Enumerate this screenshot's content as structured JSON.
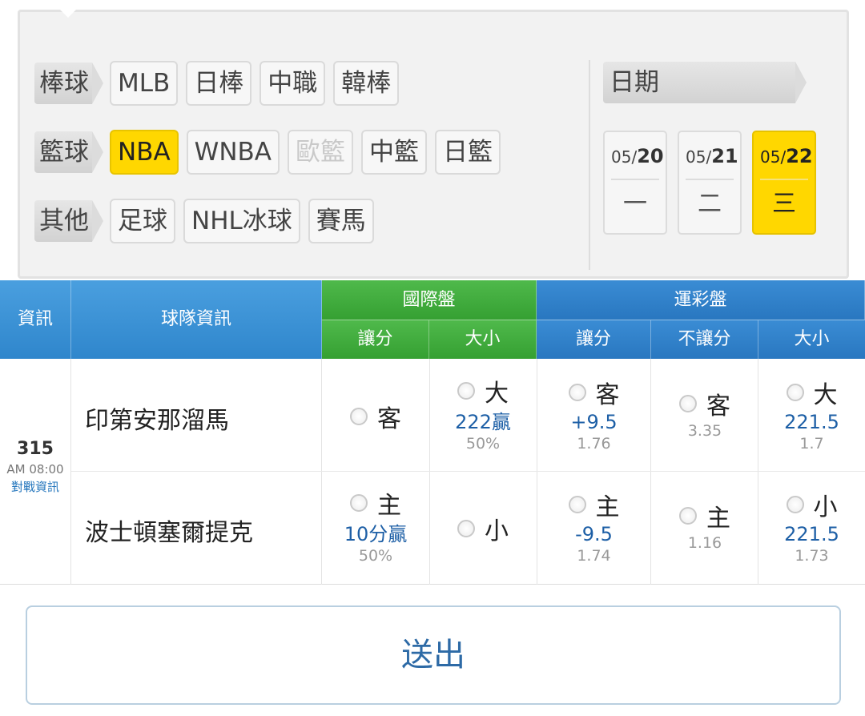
{
  "filters": {
    "rows": [
      {
        "category": "棒球",
        "chips": [
          {
            "label": "MLB",
            "state": "normal"
          },
          {
            "label": "日棒",
            "state": "normal"
          },
          {
            "label": "中職",
            "state": "normal"
          },
          {
            "label": "韓棒",
            "state": "normal"
          }
        ]
      },
      {
        "category": "籃球",
        "chips": [
          {
            "label": "NBA",
            "state": "active"
          },
          {
            "label": "WNBA",
            "state": "normal"
          },
          {
            "label": "歐籃",
            "state": "disabled"
          },
          {
            "label": "中籃",
            "state": "normal"
          },
          {
            "label": "日籃",
            "state": "normal"
          }
        ]
      },
      {
        "category": "其他",
        "chips": [
          {
            "label": "足球",
            "state": "normal"
          },
          {
            "label": "NHL冰球",
            "state": "normal"
          },
          {
            "label": "賽馬",
            "state": "normal"
          }
        ]
      }
    ],
    "date_label": "日期",
    "dates": [
      {
        "month": "05/",
        "day": "20",
        "weekday": "一",
        "active": false
      },
      {
        "month": "05/",
        "day": "21",
        "weekday": "二",
        "active": false
      },
      {
        "month": "05/",
        "day": "22",
        "weekday": "三",
        "active": true
      }
    ]
  },
  "table": {
    "headers": {
      "info": "資訊",
      "team_info": "球隊資訊",
      "intl_group": "國際盤",
      "intl_spread": "讓分",
      "intl_total": "大小",
      "lottery_group": "運彩盤",
      "lottery_spread": "讓分",
      "lottery_moneyline": "不讓分",
      "lottery_total": "大小"
    },
    "game": {
      "number": "315",
      "time": "AM 08:00",
      "link": "對戰資訊"
    },
    "rows": [
      {
        "team": "印第安那溜馬",
        "intl_spread": {
          "pick": "客",
          "line": "",
          "pct": ""
        },
        "intl_total": {
          "pick": "大",
          "line": "222贏",
          "pct": "50%"
        },
        "lottery_spread": {
          "pick": "客",
          "line": "+9.5",
          "odds": "1.76"
        },
        "lottery_moneyline": {
          "pick": "客",
          "odds": "3.35"
        },
        "lottery_total": {
          "pick": "大",
          "line": "221.5",
          "odds": "1.7"
        }
      },
      {
        "team": "波士頓塞爾提克",
        "intl_spread": {
          "pick": "主",
          "line": "10分贏",
          "pct": "50%"
        },
        "intl_total": {
          "pick": "小",
          "line": "",
          "pct": ""
        },
        "lottery_spread": {
          "pick": "主",
          "line": "-9.5",
          "odds": "1.74"
        },
        "lottery_moneyline": {
          "pick": "主",
          "odds": "1.16"
        },
        "lottery_total": {
          "pick": "小",
          "line": "221.5",
          "odds": "1.73"
        }
      }
    ]
  },
  "submit_label": "送出"
}
